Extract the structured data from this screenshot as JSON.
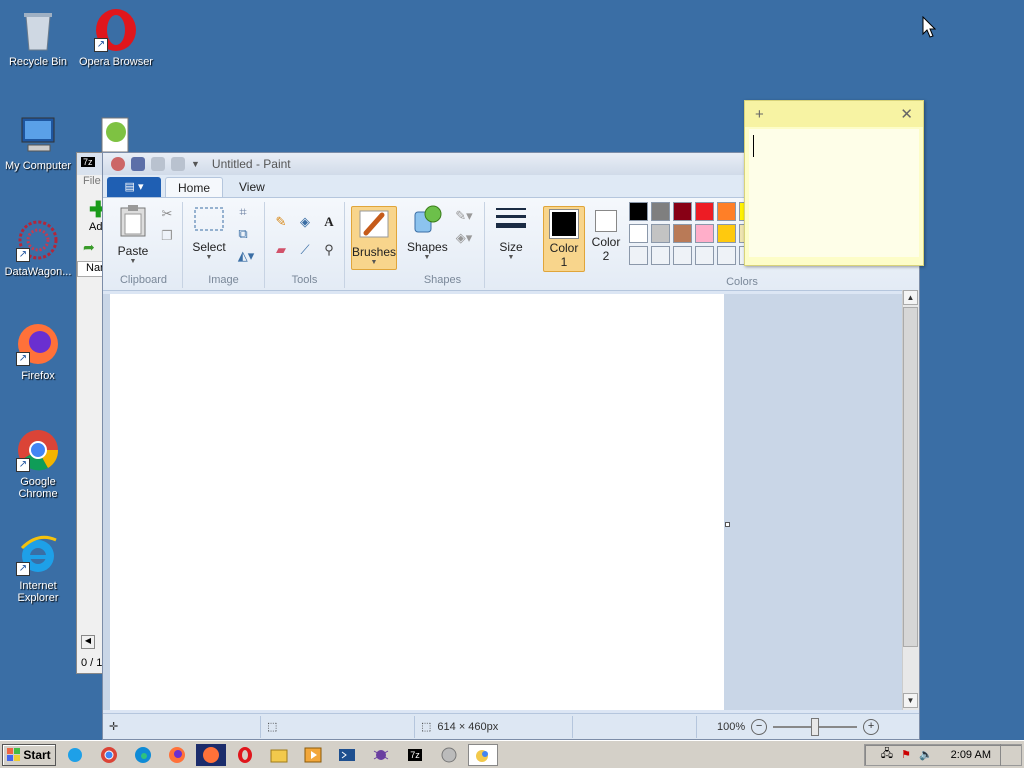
{
  "desktop": {
    "icons": [
      {
        "label": "Recycle Bin"
      },
      {
        "label": "Opera Browser"
      },
      {
        "label": "My Computer"
      },
      {
        "label": "DataWagon..."
      },
      {
        "label": "Firefox"
      },
      {
        "label": "Google Chrome"
      },
      {
        "label": "Internet Explorer"
      }
    ]
  },
  "zip": {
    "menu_file": "File",
    "add_label": "Ad",
    "col_name": "Nar",
    "status": "0 / 1"
  },
  "paint": {
    "title": "Untitled - Paint",
    "tabs": {
      "home": "Home",
      "view": "View"
    },
    "groups": {
      "clipboard": "Clipboard",
      "image": "Image",
      "tools": "Tools",
      "shapes": "Shapes",
      "colors": "Colors"
    },
    "buttons": {
      "paste": "Paste",
      "select": "Select",
      "brushes": "Brushes",
      "shapes": "Shapes",
      "size": "Size",
      "color1_a": "Color",
      "color1_b": "1",
      "color2_a": "Color",
      "color2_b": "2"
    },
    "palette": [
      "#000000",
      "#7f7f7f",
      "#880015",
      "#ed1c24",
      "#ff7f27",
      "#fff200",
      "#ffffff",
      "#c3c3c3",
      "#b97a57",
      "#ffaec9",
      "#ffc90e",
      "#efe4b0"
    ],
    "status": {
      "dimensions": "614 × 460px",
      "zoom": "100%"
    }
  },
  "taskbar": {
    "start": "Start",
    "clock": "2:09 AM"
  }
}
